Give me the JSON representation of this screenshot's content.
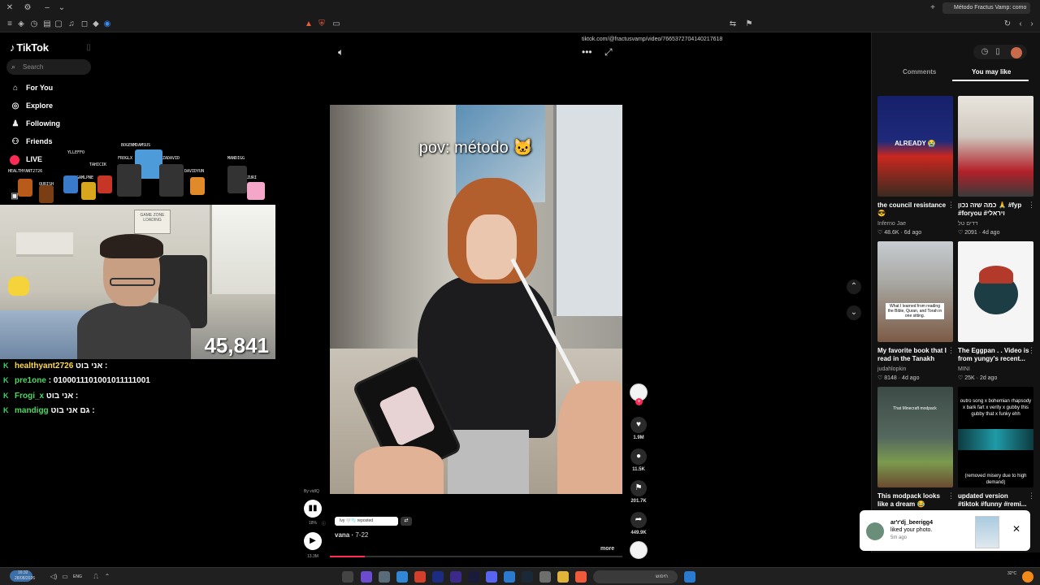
{
  "browser": {
    "url": "tiktok.com/@fractusvamp/video/7665372704140217618",
    "tab_title": "Método Fractus Vamp: como"
  },
  "tiktok": {
    "brand": "TikTok",
    "search_placeholder": "Search",
    "nav": [
      {
        "label": "For You",
        "icon": "home-icon"
      },
      {
        "label": "Explore",
        "icon": "compass-icon"
      },
      {
        "label": "Following",
        "icon": "following-icon"
      },
      {
        "label": "Friends",
        "icon": "friends-icon"
      },
      {
        "label": "LIVE",
        "icon": "live-icon"
      }
    ]
  },
  "stream": {
    "sprite_names": [
      "HEALTHYANT2726",
      "YLLEFFO",
      "BOGENMDAMSUS",
      "FROGLX",
      "ZADAVID",
      "DAVIDYUN",
      "MANDIGG",
      "ZURI",
      "QURISH",
      "GAMLPNE",
      "TAHICIK"
    ],
    "poster_text": "GAME ZONE",
    "poster_sub": "LOADING",
    "viewer_counter": "45,841",
    "chat": [
      {
        "user": "healthyant2726",
        "msg": "אני בוט :"
      },
      {
        "user": "pre1one",
        "msg": ": 0100011101001011111001"
      },
      {
        "user": "Frogi_x",
        "msg": "אני בוט :"
      },
      {
        "user": "mandigg",
        "msg": "גם אני בוט :"
      }
    ]
  },
  "video": {
    "caption": "pov: método 🐱",
    "author": "vana",
    "date": "7-22",
    "repost_label": "Ivy 🤍🫧 reposted",
    "more_label": "more",
    "by_label": "By vidIQ",
    "side_label_top": "18%",
    "side_label_bottom": "13.3M",
    "progress": 0.12,
    "actions": [
      {
        "name": "like",
        "count": "1.9M",
        "icon": "heart-icon"
      },
      {
        "name": "comment",
        "count": "11.5K",
        "icon": "comment-icon"
      },
      {
        "name": "save",
        "count": "201.7K",
        "icon": "bookmark-icon"
      },
      {
        "name": "share",
        "count": "449.9K",
        "icon": "share-icon"
      }
    ]
  },
  "panel": {
    "tabs": [
      "Comments",
      "You may like"
    ],
    "active_tab": "You may like",
    "cards": [
      {
        "title": "the council resistance 😎",
        "author": "Inferno Jae",
        "likes": "48.6K",
        "age": "6d ago",
        "thumb_text": "ALREADY 😭",
        "thumb_color_a": "#16206a",
        "thumb_color_b": "#c9281f"
      },
      {
        "title": "כמה שזה נכון 🙏 #fyp #foryou #ויראלי",
        "author": "דדים טל",
        "likes": "2091",
        "age": "4d ago",
        "thumb_text": "",
        "thumb_color_a": "#d9d5cf",
        "thumb_color_b": "#b4202a"
      },
      {
        "title": "My favorite book that I read in the Tanakh #je...",
        "author": "judahlopkin",
        "likes": "8148",
        "age": "4d ago",
        "thumb_text": "What I learned from reading the Bible, Quran, and Torah in one sitting.",
        "thumb_color_a": "#c7ccd1",
        "thumb_color_b": "#7c5a45"
      },
      {
        "title": "The Eggpan . . Video is from yungy's recent...",
        "author": "MINI",
        "likes": "25K",
        "age": "2d ago",
        "thumb_text": "",
        "thumb_color_a": "#f5f5f5",
        "thumb_color_b": "#1d3d44"
      },
      {
        "title": "This modpack looks like a dream 😂 #minecraf...",
        "author": "",
        "likes": "",
        "age": "",
        "thumb_text": "That Minecraft modpack",
        "thumb_color_a": "#3c4a46",
        "thumb_color_b": "#7b9a4f"
      },
      {
        "title": "updated version #tiktok #funny #remi...",
        "author": "",
        "likes": "",
        "age": "",
        "thumb_text": "outro song x bohemian rhapsody x bark fart x verity x gubby this gubby that x funky ehh",
        "thumb_color_a": "#ffffff",
        "thumb_color_b": "#1f9aa7"
      }
    ],
    "card_footnote": "(removed misery due to high demand)"
  },
  "notification": {
    "name": "ar'r'dj_beerigg4",
    "text": "liked your photo.",
    "time": "5m ago"
  },
  "taskbar": {
    "time": "16:32",
    "date": "28/08/2026",
    "lang": "ENG",
    "search_label": "חיפוש",
    "weather": "32°C"
  }
}
